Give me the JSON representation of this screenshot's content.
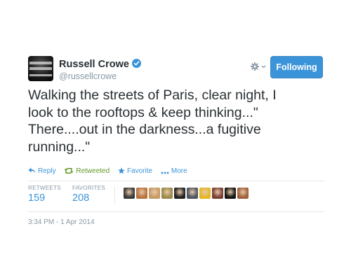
{
  "author": {
    "name": "Russell Crowe",
    "handle": "@russellcrowe",
    "verified": true,
    "avatar_icon": "author-avatar"
  },
  "follow_button": {
    "label": "Following",
    "color": "#3b94d9"
  },
  "settings_icon": "gear-icon",
  "tweet": {
    "text_lines": [
      "Walking the streets of Paris, clear night, I",
      "look to the rooftops & keep thinking...\"",
      "There....out in the darkness...a fugitive",
      "running...\""
    ]
  },
  "actions": {
    "reply": "Reply",
    "retweet": "Retweeted",
    "favorite": "Favorite",
    "more": "More",
    "retweet_color": "#609928",
    "link_color": "#3b94d9"
  },
  "stats": {
    "retweets_label": "RETWEETS",
    "retweets_value": "159",
    "favorites_label": "FAVORITES",
    "favorites_value": "208"
  },
  "favoriters": [
    {
      "icon": "user-avatar",
      "color": "#3a3a3a"
    },
    {
      "icon": "user-avatar",
      "color": "#b8733f"
    },
    {
      "icon": "user-avatar",
      "color": "#c79a63"
    },
    {
      "icon": "user-avatar",
      "color": "#9b8a4a"
    },
    {
      "icon": "user-avatar",
      "color": "#222222"
    },
    {
      "icon": "user-avatar",
      "color": "#4e5563"
    },
    {
      "icon": "user-avatar",
      "color": "#e3b826"
    },
    {
      "icon": "user-avatar",
      "color": "#7a3e35"
    },
    {
      "icon": "user-avatar",
      "color": "#141414"
    },
    {
      "icon": "user-avatar",
      "color": "#a0603a"
    }
  ],
  "timestamp": "3:34 PM - 1 Apr 2014"
}
